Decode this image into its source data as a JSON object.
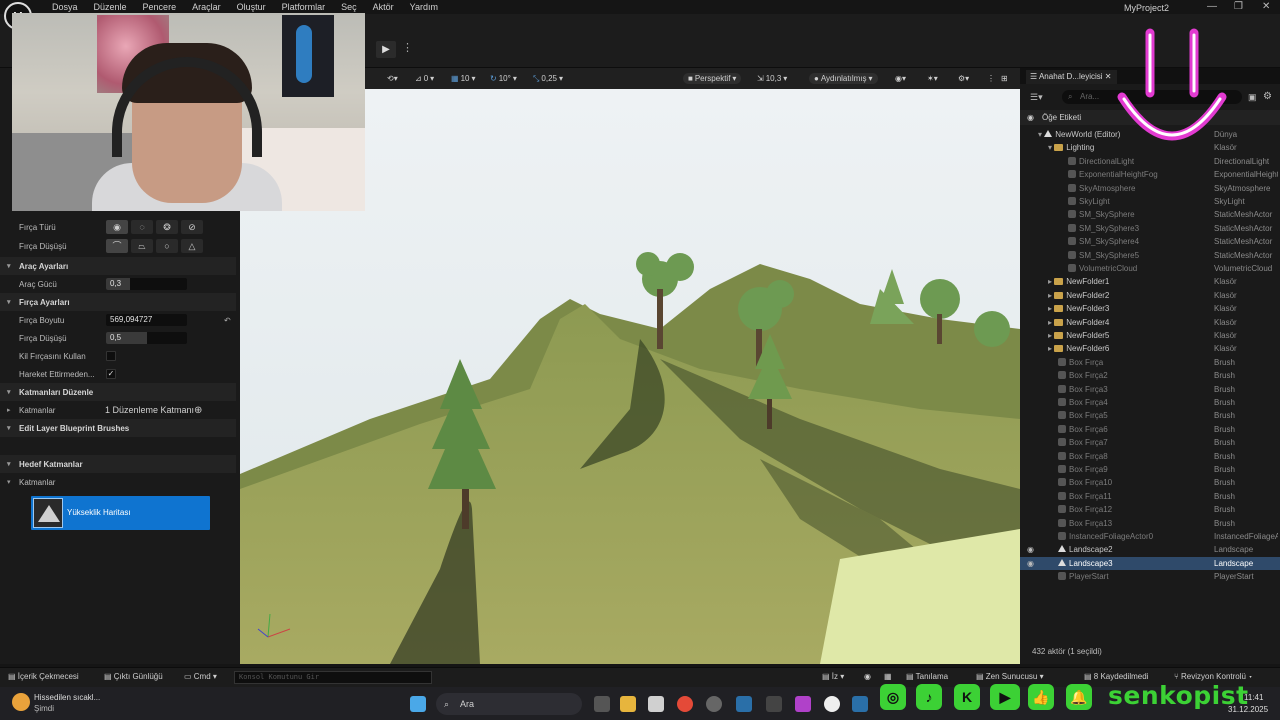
{
  "app": {
    "logo": "U",
    "menus": [
      "Dosya",
      "Düzenle",
      "Pencere",
      "Araçlar",
      "Oluştur",
      "Platformlar",
      "Seç",
      "Aktör",
      "Yardım"
    ],
    "window_title": "MyProject2",
    "controls": [
      "—",
      "❐",
      "✕"
    ]
  },
  "left_panel": {
    "brush_type_label": "Fırça Türü",
    "brush_falloff_label": "Fırça Düşüşü",
    "tool_settings": "Araç Ayarları",
    "tool_strength_label": "Araç Gücü",
    "tool_strength": "0,3",
    "tool_strength_fraction": 0.3,
    "brush_settings": "Fırça Ayarları",
    "brush_size_label": "Fırça Boyutu",
    "brush_size": "569,094727",
    "falloff_label": "Fırça Düşüşü",
    "falloff": "0,5",
    "falloff_fraction": 0.5,
    "clay_brush_label": "Kil Fırçasını Kullan",
    "clay_brush": false,
    "move_label": "Hareket Ettirmeden...",
    "move": true,
    "layers_edit": "Katmanları Düzenle",
    "layers_label": "Katmanlar",
    "layers_value": "1 Düzenleme Katmanı",
    "blueprint_brushes": "Edit Layer Blueprint Brushes",
    "target_layers": "Hedef Katmanlar",
    "target_layers_sub": "Katmanlar",
    "heightmap": "Yükseklik Haritası"
  },
  "viewport_toolbar": {
    "snap_rotate": "0",
    "grid": "10",
    "angle": "10°",
    "scale": "0,25",
    "perspective": "Perspektif",
    "fov": "10,3",
    "lit": "Aydınlatılmış"
  },
  "outliner": {
    "tab": "Anahat D...leyicisi",
    "search_placeholder": "Ara...",
    "header_label": "Öğe Etiketi",
    "header_type": "Tür",
    "rows": [
      {
        "name": "NewWorld (Editor)",
        "type": "Dünya",
        "indent": 1,
        "kind": "world",
        "dim": false
      },
      {
        "name": "Lighting",
        "type": "Klasör",
        "indent": 2,
        "kind": "folder",
        "dim": false
      },
      {
        "name": "DirectionalLight",
        "type": "DirectionalLight",
        "indent": 3,
        "kind": "actor",
        "dim": true
      },
      {
        "name": "ExponentialHeightFog",
        "type": "ExponentialHeightFog",
        "indent": 3,
        "kind": "actor",
        "dim": true
      },
      {
        "name": "SkyAtmosphere",
        "type": "SkyAtmosphere",
        "indent": 3,
        "kind": "actor",
        "dim": true
      },
      {
        "name": "SkyLight",
        "type": "SkyLight",
        "indent": 3,
        "kind": "actor",
        "dim": true
      },
      {
        "name": "SM_SkySphere",
        "type": "StaticMeshActor",
        "indent": 3,
        "kind": "actor",
        "dim": true
      },
      {
        "name": "SM_SkySphere3",
        "type": "StaticMeshActor",
        "indent": 3,
        "kind": "actor",
        "dim": true
      },
      {
        "name": "SM_SkySphere4",
        "type": "StaticMeshActor",
        "indent": 3,
        "kind": "actor",
        "dim": true
      },
      {
        "name": "SM_SkySphere5",
        "type": "StaticMeshActor",
        "indent": 3,
        "kind": "actor",
        "dim": true
      },
      {
        "name": "VolumetricCloud",
        "type": "VolumetricCloud",
        "indent": 3,
        "kind": "actor",
        "dim": true
      },
      {
        "name": "NewFolder1",
        "type": "Klasör",
        "indent": 2,
        "kind": "folder",
        "dim": false
      },
      {
        "name": "NewFolder2",
        "type": "Klasör",
        "indent": 2,
        "kind": "folder",
        "dim": false
      },
      {
        "name": "NewFolder3",
        "type": "Klasör",
        "indent": 2,
        "kind": "folder",
        "dim": false
      },
      {
        "name": "NewFolder4",
        "type": "Klasör",
        "indent": 2,
        "kind": "folder",
        "dim": false
      },
      {
        "name": "NewFolder5",
        "type": "Klasör",
        "indent": 2,
        "kind": "folder",
        "dim": false
      },
      {
        "name": "NewFolder6",
        "type": "Klasör",
        "indent": 2,
        "kind": "folder",
        "dim": false
      },
      {
        "name": "Box Fırça",
        "type": "Brush",
        "indent": 2,
        "kind": "actor",
        "dim": true
      },
      {
        "name": "Box Fırça2",
        "type": "Brush",
        "indent": 2,
        "kind": "actor",
        "dim": true
      },
      {
        "name": "Box Fırça3",
        "type": "Brush",
        "indent": 2,
        "kind": "actor",
        "dim": true
      },
      {
        "name": "Box Fırça4",
        "type": "Brush",
        "indent": 2,
        "kind": "actor",
        "dim": true
      },
      {
        "name": "Box Fırça5",
        "type": "Brush",
        "indent": 2,
        "kind": "actor",
        "dim": true
      },
      {
        "name": "Box Fırça6",
        "type": "Brush",
        "indent": 2,
        "kind": "actor",
        "dim": true
      },
      {
        "name": "Box Fırça7",
        "type": "Brush",
        "indent": 2,
        "kind": "actor",
        "dim": true
      },
      {
        "name": "Box Fırça8",
        "type": "Brush",
        "indent": 2,
        "kind": "actor",
        "dim": true
      },
      {
        "name": "Box Fırça9",
        "type": "Brush",
        "indent": 2,
        "kind": "actor",
        "dim": true
      },
      {
        "name": "Box Fırça10",
        "type": "Brush",
        "indent": 2,
        "kind": "actor",
        "dim": true
      },
      {
        "name": "Box Fırça11",
        "type": "Brush",
        "indent": 2,
        "kind": "actor",
        "dim": true
      },
      {
        "name": "Box Fırça12",
        "type": "Brush",
        "indent": 2,
        "kind": "actor",
        "dim": true
      },
      {
        "name": "Box Fırça13",
        "type": "Brush",
        "indent": 2,
        "kind": "actor",
        "dim": true
      },
      {
        "name": "InstancedFoliageActor0",
        "type": "InstancedFoliageActor",
        "indent": 2,
        "kind": "actor",
        "dim": true
      },
      {
        "name": "Landscape2",
        "type": "Landscape",
        "indent": 2,
        "kind": "landscape",
        "dim": false
      },
      {
        "name": "Landscape3",
        "type": "Landscape",
        "indent": 2,
        "kind": "landscape",
        "dim": false,
        "selected": true
      },
      {
        "name": "PlayerStart",
        "type": "PlayerStart",
        "indent": 2,
        "kind": "actor",
        "dim": true
      }
    ],
    "footer": "432 aktör (1 seçildi)"
  },
  "statusbar": {
    "content_drawer": "İçerik Çekmecesi",
    "output_log": "Çıktı Günlüğü",
    "cmd": "Cmd",
    "cmd_placeholder": "Konsol Komutunu Gir",
    "derived_data": "Tanılama",
    "zen": "Zen Sunucusu",
    "unsaved": "8 Kaydedilmedi",
    "revision": "Revizyon Kontrolü"
  },
  "taskbar": {
    "weather_title": "Hissedilen sıcakl...",
    "weather_sub": "Şimdi",
    "search": "Ara",
    "time": "11:41",
    "date": "31.12.2025"
  },
  "overlay": {
    "brand": "senkopist",
    "brand_color": "#3cd135",
    "smile_color": "#e23bd1"
  }
}
